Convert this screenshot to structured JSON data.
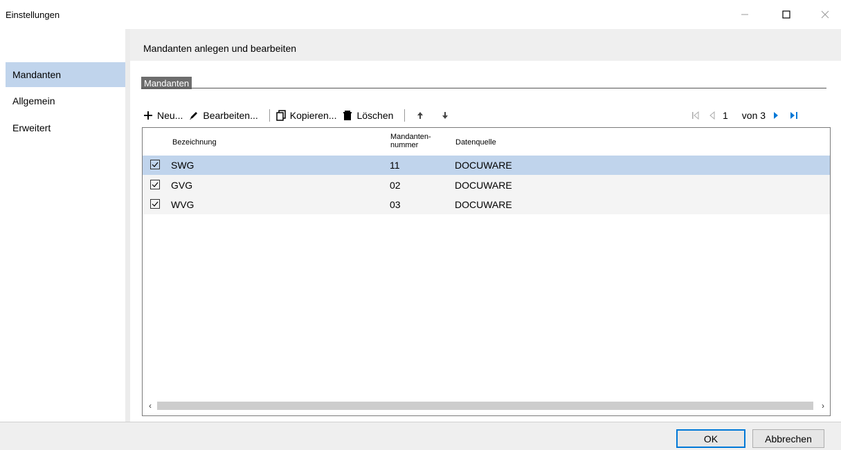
{
  "window": {
    "title": "Einstellungen"
  },
  "sidebar": {
    "items": [
      {
        "label": "Mandanten",
        "active": true
      },
      {
        "label": "Allgemein",
        "active": false
      },
      {
        "label": "Erweitert",
        "active": false
      }
    ]
  },
  "content": {
    "header": "Mandanten anlegen und bearbeiten",
    "group_title": "Mandanten"
  },
  "toolbar": {
    "new_label": "Neu...",
    "edit_label": "Bearbeiten...",
    "copy_label": "Kopieren...",
    "delete_label": "Löschen"
  },
  "pager": {
    "current_page": "1",
    "total_label": "von 3"
  },
  "grid": {
    "columns": {
      "name": "Bezeichnung",
      "number_line1": "Mandanten-",
      "number_line2": "nummer",
      "source": "Datenquelle"
    },
    "rows": [
      {
        "checked": true,
        "name": "SWG",
        "number": "11",
        "source": "DOCUWARE",
        "selected": true
      },
      {
        "checked": true,
        "name": "GVG",
        "number": "02",
        "source": "DOCUWARE",
        "selected": false
      },
      {
        "checked": true,
        "name": "WVG",
        "number": "03",
        "source": "DOCUWARE",
        "selected": false
      }
    ]
  },
  "footer": {
    "ok_label": "OK",
    "cancel_label": "Abbrechen"
  },
  "colors": {
    "selection": "#c0d4ec",
    "accent": "#0078d7",
    "pager_active": "#0078d7"
  }
}
